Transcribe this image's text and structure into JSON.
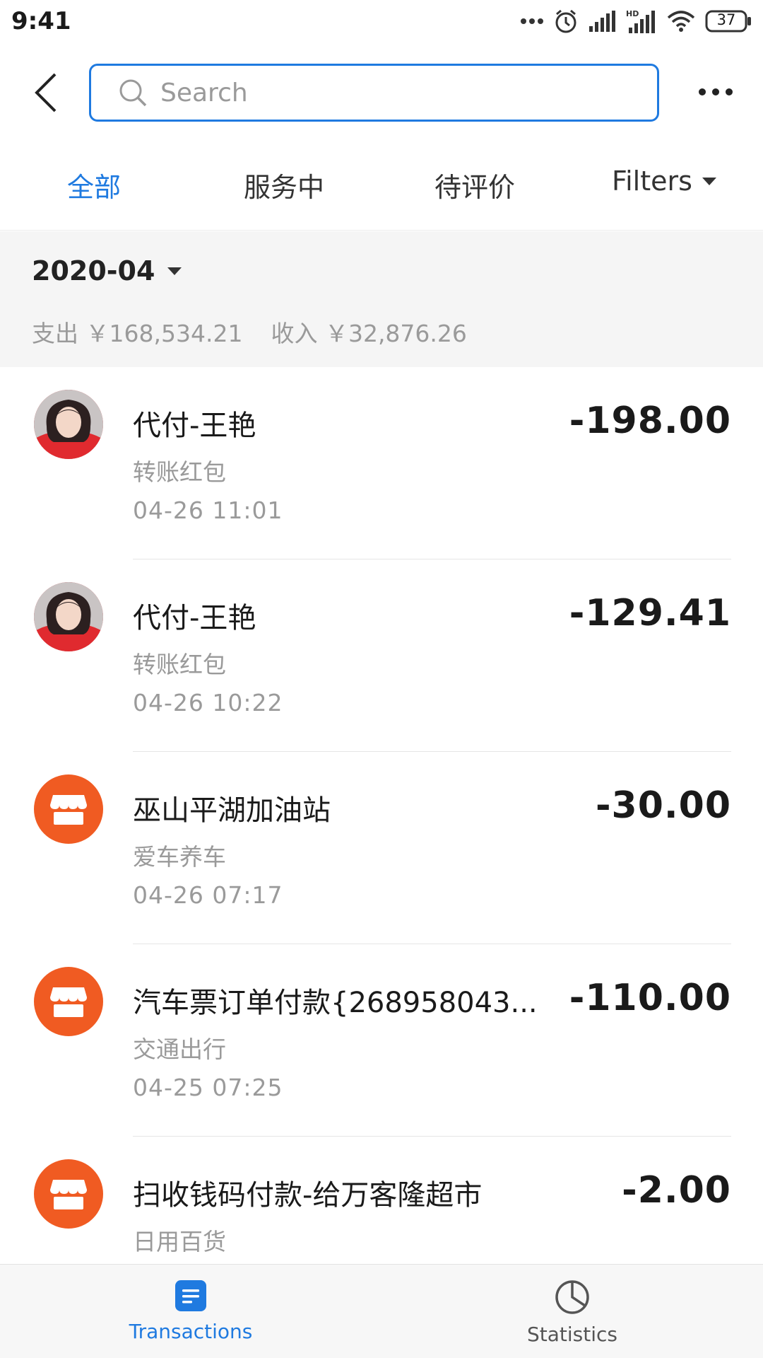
{
  "status_bar": {
    "time": "9:41",
    "battery": "37",
    "icons": [
      "more-dots-icon",
      "alarm-icon",
      "signal-icon",
      "hd-signal-icon",
      "wifi-icon",
      "battery-icon"
    ]
  },
  "header": {
    "search_placeholder": "Search",
    "back_icon": "chevron-left-icon",
    "more_icon": "more-horizontal-icon"
  },
  "tabs": [
    {
      "label": "全部",
      "active": true
    },
    {
      "label": "服务中",
      "active": false
    },
    {
      "label": "待评价",
      "active": false
    },
    {
      "label": "Filters",
      "active": false
    }
  ],
  "summary": {
    "month": "2020-04",
    "expense_label": "支出",
    "expense_value": "￥168,534.21",
    "income_label": "收入",
    "income_value": "￥32,876.26"
  },
  "transactions": [
    {
      "title": "代付-王艳",
      "category": "转账红包",
      "time": "04-26  11:01",
      "amount": "-198.00",
      "avatar": "photo"
    },
    {
      "title": "代付-王艳",
      "category": "转账红包",
      "time": "04-26  10:22",
      "amount": "-129.41",
      "avatar": "photo"
    },
    {
      "title": "巫山平湖加油站",
      "category": "爱车养车",
      "time": "04-26  07:17",
      "amount": "-30.00",
      "avatar": "store"
    },
    {
      "title": "汽车票订单付款{268958043...",
      "category": "交通出行",
      "time": "04-25  07:25",
      "amount": "-110.00",
      "avatar": "store"
    },
    {
      "title": "扫收钱码付款-给万客隆超市",
      "category": "日用百货",
      "time": "",
      "amount": "-2.00",
      "avatar": "store"
    }
  ],
  "bottom_nav": {
    "transactions_label": "Transactions",
    "statistics_label": "Statistics"
  },
  "colors": {
    "accent": "#1f7ae0",
    "store_orange": "#f05b22",
    "summary_bg": "#f5f5f5"
  }
}
